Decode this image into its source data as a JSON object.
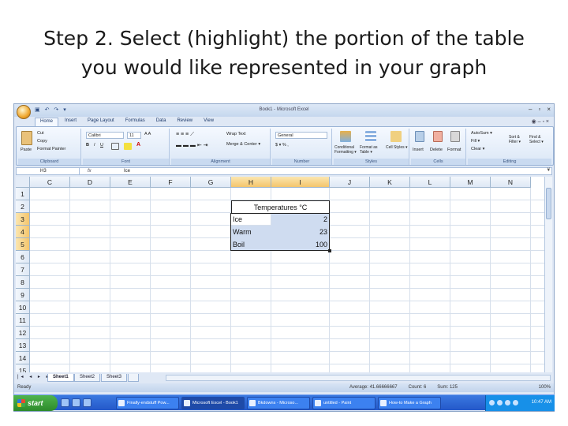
{
  "slide": {
    "title_line1": "Step 2. Select (highlight) the portion of the  table",
    "title_line2": "you would like represented in your graph"
  },
  "window": {
    "title": "Book1 - Microsoft Excel",
    "controls": [
      "–",
      "▫",
      "×"
    ]
  },
  "ribbon": {
    "tabs": [
      "Home",
      "Insert",
      "Page Layout",
      "Formulas",
      "Data",
      "Review",
      "View"
    ],
    "active_tab": "Home",
    "clipboard": {
      "paste": "Paste",
      "cut": "Cut",
      "copy": "Copy",
      "format_painter": "Format Painter",
      "label": "Clipboard"
    },
    "font": {
      "name": "Calibri",
      "size": "11",
      "label": "Font"
    },
    "alignment": {
      "wrap_text": "Wrap Text",
      "merge_center": "Merge & Center ▾",
      "label": "Alignment"
    },
    "number": {
      "format": "General",
      "symbols": "$ ▾  %  ,",
      "label": "Number"
    },
    "styles": {
      "conditional": "Conditional Formatting ▾",
      "format_table": "Format as Table ▾",
      "cell_styles": "Cell Styles ▾",
      "label": "Styles"
    },
    "cells": {
      "insert": "Insert",
      "delete": "Delete",
      "format": "Format",
      "label": "Cells"
    },
    "editing": {
      "autosum": "AutoSum ▾",
      "fill": "Fill ▾",
      "clear": "Clear ▾",
      "sort": "Sort & Filter ▾",
      "find": "Find & Select ▾",
      "label": "Editing"
    }
  },
  "formula_bar": {
    "name_box": "H3",
    "fx": "fx",
    "content": "Ice"
  },
  "grid": {
    "columns": [
      "C",
      "D",
      "E",
      "F",
      "G",
      "H",
      "I",
      "J",
      "K",
      "L",
      "M",
      "N"
    ],
    "selected_columns": [
      "H",
      "I"
    ],
    "rows": [
      "1",
      "2",
      "3",
      "4",
      "5",
      "6",
      "7",
      "8",
      "9",
      "10",
      "11",
      "12",
      "13",
      "14",
      "15"
    ],
    "selected_rows": [
      "3",
      "4",
      "5"
    ]
  },
  "table": {
    "header": "Temperatures °C",
    "rows": [
      {
        "label": "Ice",
        "value": "2"
      },
      {
        "label": "Warm",
        "value": "23"
      },
      {
        "label": "Boil",
        "value": "100"
      }
    ]
  },
  "sheet_tabs": {
    "tabs": [
      "Sheet1",
      "Sheet2",
      "Sheet3"
    ],
    "active": "Sheet1",
    "nav": "|◂ ◂ ▸ ▸|"
  },
  "status_bar": {
    "mode": "Ready",
    "average": "Average: 41.66666667",
    "count": "Count: 6",
    "sum": "Sum: 125",
    "zoom": "100%"
  },
  "taskbar": {
    "start": "start",
    "items": [
      "Finally-endstuff Pow...",
      "Microsoft Excel - Book1",
      "Bkdowns - Microso...",
      "untitled - Paint",
      "How-to Make a Graph"
    ],
    "active_item": 1,
    "clock": "10:47 AM"
  },
  "colors": {
    "accent_selection": "#cfdcf0",
    "header_selected": "#f4c56c",
    "taskbar": "#2458c9",
    "start_button": "#2d8a2b"
  }
}
